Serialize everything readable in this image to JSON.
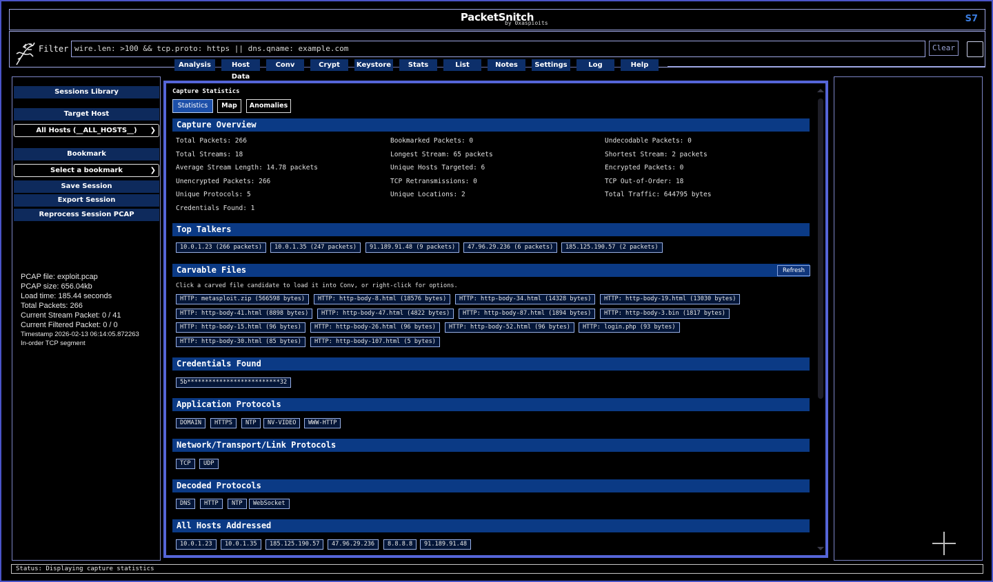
{
  "app": {
    "title": "PacketSnitch",
    "subtitle": "by 0xaspioits",
    "version_badge": "S7"
  },
  "filter": {
    "label": "Filter",
    "value": "wire.len: >100 && tcp.proto: https || dns.qname: example.com",
    "clear_label": "Clear"
  },
  "tabs": [
    "Analysis",
    "Host Data",
    "Conv",
    "Crypt",
    "Keystore",
    "Stats",
    "List",
    "Notes",
    "Settings",
    "Log",
    "Help"
  ],
  "sidebar": {
    "sessions_library": "Sessions Library",
    "target_host_label": "Target Host",
    "host_select": "All Hosts (__ALL_HOSTS__)",
    "bookmark_label": "Bookmark",
    "bookmark_select": "Select a bookmark",
    "save_session": "Save Session",
    "export_session": "Export Session",
    "reprocess": "Reprocess Session PCAP",
    "info": {
      "pcap_file": "PCAP file: exploit.pcap",
      "pcap_size": "PCAP size: 656.04kb",
      "load_time": "Load time: 185.44 seconds",
      "total_packets": "Total Packets: 266",
      "stream_packet": "Current Stream Packet: 0 / 41",
      "filtered_packet": "Current Filtered Packet: 0 / 0",
      "timestamp": "Timestamp 2026-02-13 06:14:05.872263",
      "segment": "In-order TCP segment"
    }
  },
  "main": {
    "title": "Capture Statistics",
    "subtabs": [
      "Statistics",
      "Map",
      "Anomalies"
    ],
    "sections": {
      "overview": "Capture Overview",
      "top_talkers": "Top Talkers",
      "carvable": "Carvable Files",
      "credentials": "Credentials Found",
      "app_protocols": "Application Protocols",
      "net_protocols": "Network/Transport/Link Protocols",
      "decoded": "Decoded Protocols",
      "hosts": "All Hosts Addressed"
    },
    "overview_stats": [
      [
        "Total Packets: 266",
        "Bookmarked Packets: 0",
        "Undecodable Packets: 0"
      ],
      [
        "Total Streams: 18",
        "Longest Stream: 65 packets",
        "Shortest Stream: 2 packets"
      ],
      [
        "Average Stream Length: 14.78 packets",
        "Unique Hosts Targeted: 6",
        "Encrypted Packets: 0"
      ],
      [
        "Unencrypted Packets: 266",
        "TCP Retransmissions: 0",
        "TCP Out-of-Order: 18"
      ],
      [
        "Unique Protocols: 5",
        "Unique Locations: 2",
        "Total Traffic: 644795 bytes"
      ],
      [
        "Credentials Found: 1",
        "",
        ""
      ]
    ],
    "top_talkers": [
      "10.0.1.23 (266 packets)",
      "10.0.1.35 (247 packets)",
      "91.189.91.48 (9 packets)",
      "47.96.29.236 (6 packets)",
      "185.125.190.57 (2 packets)"
    ],
    "refresh_label": "Refresh",
    "carvable_hint": "Click a carved file candidate to load it into Conv, or right-click for options.",
    "carvable_files": [
      [
        "HTTP: metasploit.zip (566598 bytes)",
        "HTTP: http-body-8.html (18576 bytes)",
        "HTTP: http-body-34.html (14328 bytes)",
        "HTTP: http-body-19.html (13030 bytes)"
      ],
      [
        "HTTP: http-body-41.html (8898 bytes)",
        "HTTP: http-body-47.html (4822 bytes)",
        "HTTP: http-body-87.html (1894 bytes)",
        "HTTP: http-body-3.bin (1817 bytes)"
      ],
      [
        "HTTP: http-body-15.html (96 bytes)",
        "HTTP: http-body-26.html (96 bytes)",
        "HTTP: http-body-52.html (96 bytes)",
        "HTTP: login.php (93 bytes)"
      ],
      [
        "HTTP: http-body-30.html (85 bytes)",
        "HTTP: http-body-107.html (5 bytes)"
      ]
    ],
    "credentials": [
      "5b**************************32"
    ],
    "app_protocols": [
      "DOMAIN",
      "HTTPS",
      "NTP",
      "NV-VIDEO",
      "WWW-HTTP"
    ],
    "net_protocols": [
      "TCP",
      "UDP"
    ],
    "decoded_protocols": [
      "DNS",
      "HTTP",
      "NTP",
      "WebSocket"
    ],
    "hosts": [
      "10.0.1.23",
      "10.0.1.35",
      "185.125.190.57",
      "47.96.29.236",
      "8.8.8.8",
      "91.189.91.48"
    ]
  },
  "status": "Status: Displaying capture statistics",
  "colors": {
    "accent": "#5565d8",
    "section_bar": "#0b3a85",
    "button": "#0e2a5c",
    "version": "#3a7ce0"
  }
}
